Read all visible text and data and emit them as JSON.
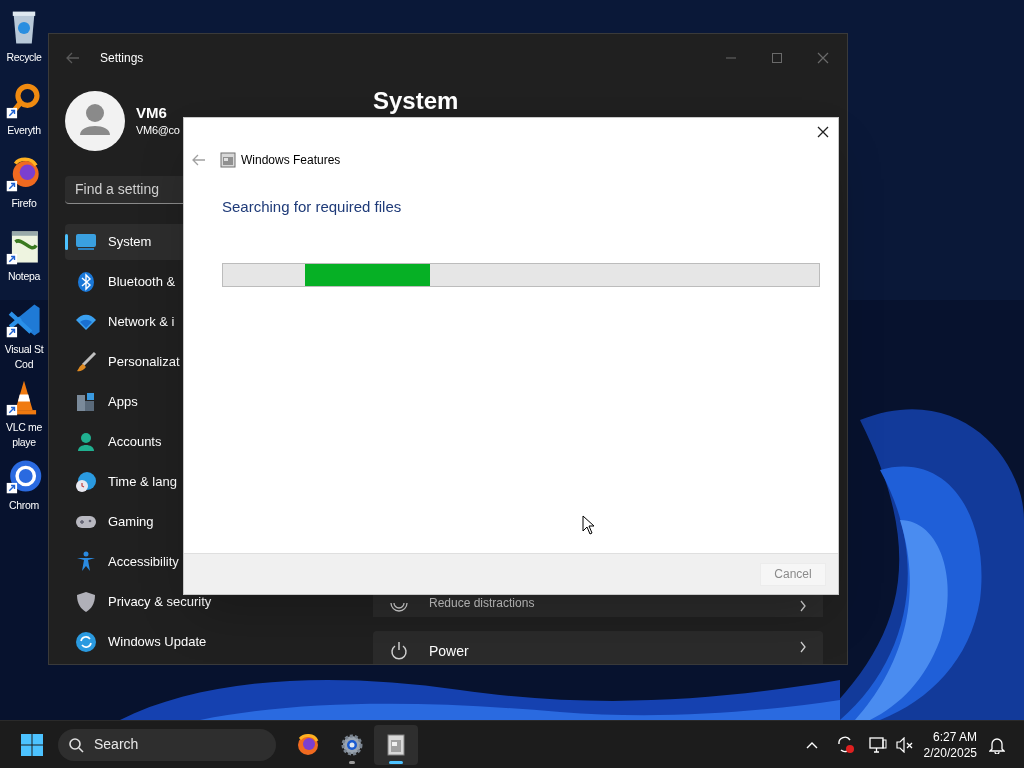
{
  "desktop_icons": [
    {
      "label": [
        "Recycle"
      ]
    },
    {
      "label": [
        "Everyth"
      ]
    },
    {
      "label": [
        "Firefo"
      ]
    },
    {
      "label": [
        "Notepa"
      ]
    },
    {
      "label": [
        "Visual St",
        "Cod"
      ]
    },
    {
      "label": [
        "VLC me",
        "playe"
      ]
    },
    {
      "label": [
        "Chrom"
      ]
    }
  ],
  "settings_window": {
    "title": "Settings",
    "account": {
      "name": "VM6",
      "email": "VM6@co"
    },
    "search": {
      "placeholder": "Find a setting"
    },
    "nav": [
      {
        "label": "System",
        "selected": true
      },
      {
        "label": "Bluetooth &",
        "selected": false
      },
      {
        "label": "Network & i",
        "selected": false
      },
      {
        "label": "Personalizat",
        "selected": false
      },
      {
        "label": "Apps",
        "selected": false
      },
      {
        "label": "Accounts",
        "selected": false
      },
      {
        "label": "Time & lang",
        "selected": false
      },
      {
        "label": "Gaming",
        "selected": false
      },
      {
        "label": "Accessibility",
        "selected": false
      },
      {
        "label": "Privacy & security",
        "selected": false
      },
      {
        "label": "Windows Update",
        "selected": false
      }
    ],
    "heading": "System",
    "cards": [
      {
        "subtitle": "Reduce distractions"
      },
      {
        "title": "Power"
      }
    ]
  },
  "dialog": {
    "title": "Windows Features",
    "message": "Searching for required files",
    "progress": {
      "kind": "marquee",
      "level": 0.21
    },
    "buttons": [
      {
        "label": "Cancel",
        "disabled": true
      }
    ]
  },
  "taskbar": {
    "search": {
      "placeholder": "Search"
    },
    "apps": [
      {
        "kind": "browser",
        "open": false,
        "selected": false
      },
      {
        "kind": "settings",
        "open": true,
        "selected": false
      },
      {
        "kind": "features",
        "open": true,
        "selected": true
      }
    ],
    "clock": {
      "time": "6:27 AM",
      "date": "2/20/2025"
    }
  }
}
